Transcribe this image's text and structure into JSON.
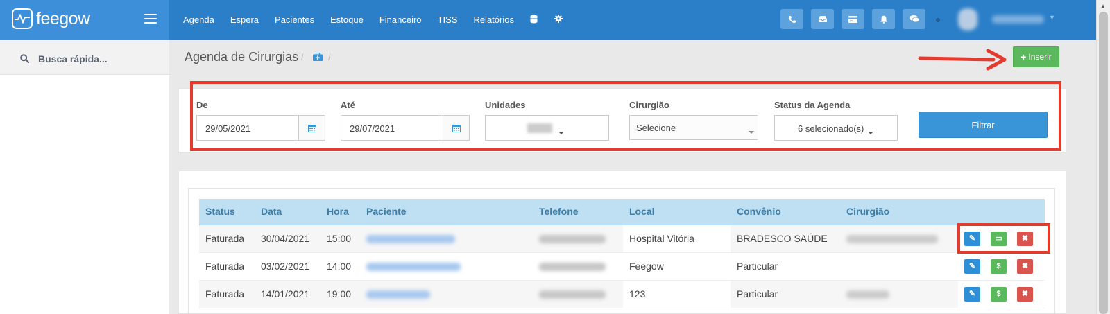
{
  "app": {
    "brand": "feegow"
  },
  "nav": {
    "items": [
      "Agenda",
      "Espera",
      "Pacientes",
      "Estoque",
      "Financeiro",
      "TISS",
      "Relatórios"
    ],
    "icons": [
      "database-icon",
      "gear-icon"
    ]
  },
  "header_icons": [
    "phone-icon",
    "inbox-icon",
    "card-icon",
    "bell-icon",
    "chat-icon"
  ],
  "sidebar": {
    "search_placeholder": "Busca rápida..."
  },
  "page": {
    "title": "Agenda de Cirurgias",
    "insert_label": "Inserir"
  },
  "filters": {
    "from_label": "De",
    "from_value": "29/05/2021",
    "to_label": "Até",
    "to_value": "29/07/2021",
    "units_label": "Unidades",
    "surgeon_label": "Cirurgião",
    "surgeon_value": "Selecione",
    "status_label": "Status da Agenda",
    "status_value": "6 selecionado(s)",
    "filter_button": "Filtrar"
  },
  "table": {
    "headers": [
      "Status",
      "Data",
      "Hora",
      "Paciente",
      "Telefone",
      "Local",
      "Convênio",
      "Cirurgião"
    ],
    "rows": [
      {
        "status": "Faturada",
        "date": "30/04/2021",
        "time": "15:00",
        "local": "Hospital Vitória",
        "insurance": "BRADESCO SAÚDE"
      },
      {
        "status": "Faturada",
        "date": "03/02/2021",
        "time": "14:00",
        "local": "Feegow",
        "insurance": "Particular"
      },
      {
        "status": "Faturada",
        "date": "14/01/2021",
        "time": "19:00",
        "local": "123",
        "insurance": "Particular"
      }
    ]
  },
  "colors": {
    "topbar": "#2b7fc9",
    "header_accent": "#bfe0f3",
    "annotation": "#e53b2f"
  }
}
